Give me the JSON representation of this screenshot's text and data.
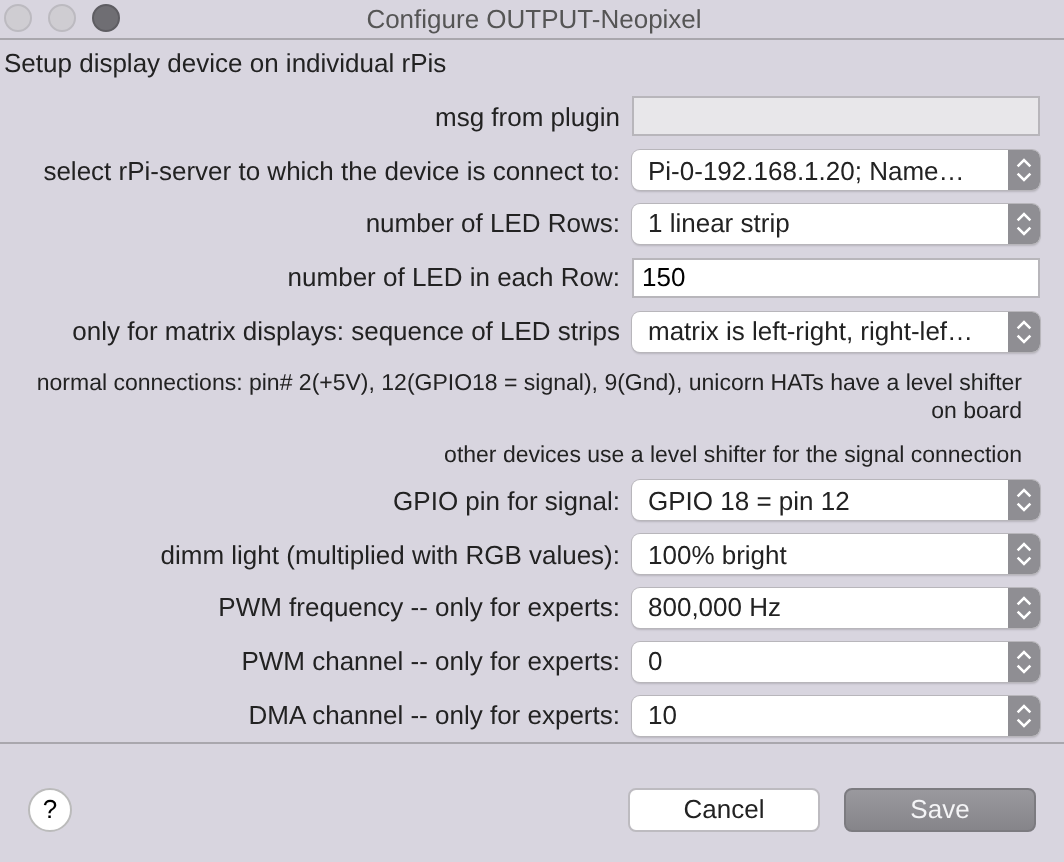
{
  "window": {
    "title": "Configure OUTPUT-Neopixel"
  },
  "heading": "Setup display device on individual rPis",
  "rows": [
    {
      "kind": "field",
      "label": "msg from plugin",
      "disabled": true
    },
    {
      "kind": "select",
      "label": "select rPi-server to which the device is connect to:",
      "value": "Pi-0-192.168.1.20;  Name…"
    },
    {
      "kind": "select",
      "label": "number of LED Rows:",
      "value": "1 linear strip"
    },
    {
      "kind": "field",
      "label": "number of LED in each Row:",
      "value": "150",
      "disabled": false
    },
    {
      "kind": "select",
      "label": "only for matrix displays: sequence of LED strips",
      "value": "matrix is left-right, right-lef…"
    },
    {
      "kind": "note",
      "text": "normal connections: pin# 2(+5V), 12(GPIO18 = signal), 9(Gnd), unicorn HATs have a level shifter on board"
    },
    {
      "kind": "note",
      "text": "other devices use a level shifter for the signal connection"
    },
    {
      "kind": "select",
      "label": "GPIO pin for signal:",
      "value": "GPIO 18 = pin 12"
    },
    {
      "kind": "select",
      "label": "dimm light (multiplied with RGB values):",
      "value": "100% bright"
    },
    {
      "kind": "select",
      "label": "PWM frequency -- only for experts:",
      "value": "800,000 Hz"
    },
    {
      "kind": "select",
      "label": "PWM channel -- only for experts:",
      "value": "0"
    },
    {
      "kind": "select",
      "label": "DMA channel -- only for experts:",
      "value": "10"
    }
  ],
  "help_button": "?",
  "buttons": [
    {
      "label": "Cancel",
      "default": false
    },
    {
      "label": "Save",
      "default": true
    }
  ]
}
